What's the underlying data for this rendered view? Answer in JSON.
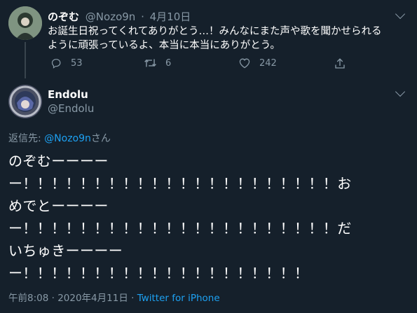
{
  "colors": {
    "background": "#15202b",
    "text": "#ffffff",
    "muted": "#8899a6",
    "link": "#1da1f2",
    "thread_line": "#38444d"
  },
  "tweet1": {
    "display_name": "のぞむ",
    "handle": "@Nozo9n",
    "separator": "·",
    "date": "4月10日",
    "text_line1": "お誕生日祝ってくれてありがとう…！みんなにまた声や歌を聞かせられる",
    "text_line2": "ように頑張っているよ、本当に本当にありがとう。",
    "actions": {
      "reply_icon": "reply-icon",
      "reply_count": "53",
      "retweet_icon": "retweet-icon",
      "retweet_count": "6",
      "like_icon": "heart-icon",
      "like_count": "242",
      "share_icon": "share-icon"
    }
  },
  "tweet2": {
    "display_name": "Endolu",
    "handle": "@Endolu",
    "reply_prefix": "返信先: ",
    "reply_handle": "@Nozo9n",
    "reply_suffix": "さん",
    "text_lines": [
      "のぞむーーーー",
      "ー！！！！！！！！！！！！！！！！！！！！！！お",
      "めでとーーーー",
      "ー！！！！！！！！！！！！！！！！！！！！！！だ",
      "いちゅきーーーー",
      "ー！！！！！！！！！！！！！！！！！！！！"
    ],
    "timestamp": "午前8:08 · 2020年4月11日 · ",
    "client": "Twitter for iPhone"
  }
}
